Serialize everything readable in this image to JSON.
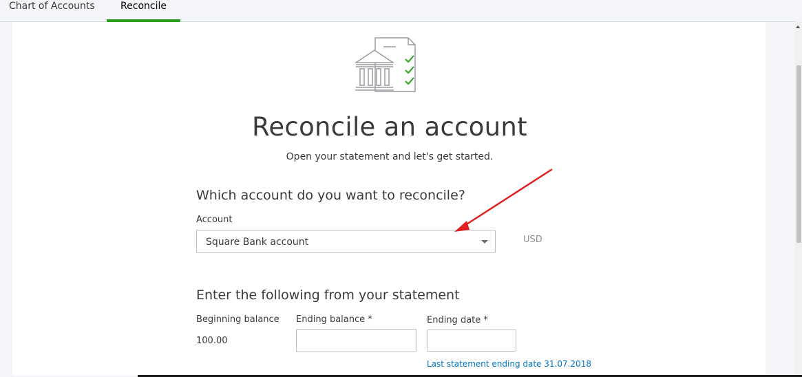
{
  "tabs": [
    {
      "label": "Chart of Accounts",
      "active": false
    },
    {
      "label": "Reconcile",
      "active": true
    }
  ],
  "colors": {
    "accent": "#2ca01c",
    "link": "#0077c5",
    "arrow": "#e02020",
    "text": "#393a3d"
  },
  "icons": {
    "hero": "bank-statement-checklist-icon",
    "dropdown": "chevron-down-icon",
    "annotation": "red-arrow-icon"
  },
  "main": {
    "title": "Reconcile an account",
    "subtitle": "Open your statement and let's get started."
  },
  "account_section": {
    "heading": "Which account do you want to reconcile?",
    "account_label": "Account",
    "account_value": "Square Bank account",
    "currency": "USD"
  },
  "statement_section": {
    "heading": "Enter the following from your statement",
    "beginning_balance_label": "Beginning balance",
    "beginning_balance_value": "100.00",
    "ending_balance_label": "Ending balance *",
    "ending_balance_value": "",
    "ending_date_label": "Ending date *",
    "ending_date_value": "",
    "last_statement_text": "Last statement ending date 31.07.2018"
  }
}
